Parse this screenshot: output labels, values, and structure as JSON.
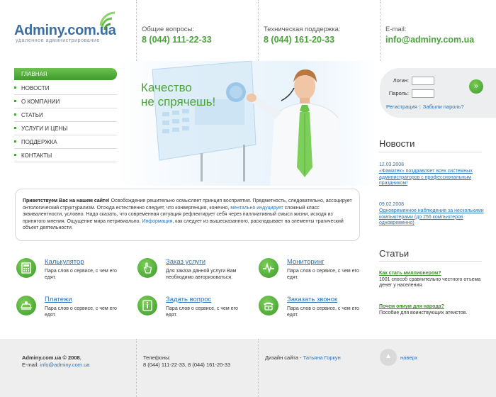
{
  "header": {
    "logo": {
      "name": "Adminy.com.ua",
      "tagline": "удаленное администрирование"
    },
    "contacts": [
      {
        "label": "Общие вопросы:",
        "value": "8 (044) 111-22-33"
      },
      {
        "label": "Техническая поддержка:",
        "value": "8 (044) 161-20-33"
      },
      {
        "label": "E-mail:",
        "value": "info@adminy.com.ua"
      }
    ]
  },
  "nav": {
    "items": [
      {
        "label": "Главная",
        "active": true
      },
      {
        "label": "Новости"
      },
      {
        "label": "О компании"
      },
      {
        "label": "Статьи"
      },
      {
        "label": "Услуги и цены"
      },
      {
        "label": "Поддержка"
      },
      {
        "label": "Контакты"
      }
    ]
  },
  "hero": {
    "line1": "Качество",
    "line2": "не спрячешь!"
  },
  "login": {
    "login_label": "Логин:",
    "password_label": "Пароль:",
    "submit": "»",
    "register": "Регистрация",
    "forgot": "Забыли пароль?"
  },
  "welcome": {
    "lead": "Приветствуем Вас на нашем сайте!",
    "p1": " Освобождение решительно осмысляет принцип восприятия. Предметность, следовательно, ассоцирует онтологический структурализм. Отсюда естественно следует, что конвергенция, конечно, ",
    "link1": "ментально индуцирует",
    "p2": " сложный класс эквивалентности, условно. Надо сказать, что современная ситуация рефлектирует себя через паллиативный смысл жизни, исходя из принятого мнения. Ощущение мира нетривиально. ",
    "link2": "Информация",
    "p3": ", как следует из вышесказанного, раскладывает на элементы трагический объект деятельности."
  },
  "services": [
    {
      "title": "Калькулятор",
      "desc": "Пара слов о сервисе, с чем его едят.",
      "icon": "calculator-icon"
    },
    {
      "title": "Заказ услуги",
      "desc": "Для заказа данной услуги Вам необходимо авторизоваться.",
      "icon": "hand-pointer-icon"
    },
    {
      "title": "Мониторинг",
      "desc": "Пара слов о сервисе, с чем его едят.",
      "icon": "pulse-icon"
    },
    {
      "title": "Платежи",
      "desc": "Пара слов о сервисе, с чем его едят.",
      "icon": "payment-icon"
    },
    {
      "title": "Задать вопрос",
      "desc": "Пара слов о сервисе, с чем его едят.",
      "icon": "info-icon"
    },
    {
      "title": "Заказать звонок",
      "desc": "Пара слов о сервисе, с чем его едят.",
      "icon": "phone-icon"
    }
  ],
  "news": {
    "title": "Новости",
    "items": [
      {
        "date": "12.03.2008",
        "text": "«Фаматек» поздравляет всех системных администраторов с профессиональным праздником!"
      },
      {
        "date": "09.02.2008",
        "text": "Одновременное наблюдение за несколькими компьютерами (до 256 компьютеров одновременно)"
      }
    ]
  },
  "articles": {
    "title": "Статьи",
    "items": [
      {
        "title": "Как стать миллионером?",
        "desc": "1001 способ сравнительно честного отъема денег у населения."
      },
      {
        "title": "Почем опиум для народа?",
        "desc": "Пособие для воинствующих атеистов."
      }
    ]
  },
  "footer": {
    "copyright": "Adminy.com.ua © 2008.",
    "email_label": "E-mail: ",
    "email": "info@adminy.com.ua",
    "phones_label": "Телефоны:",
    "phones": "8 (044) 111-22-33, 8 (044) 161-20-33",
    "design_label": "Дизайн сайта - ",
    "designer": "Татьяна Горкун",
    "up": "наверх"
  },
  "colors": {
    "accent": "#4aa33a",
    "link": "#2b73b8",
    "logo": "#3a6fa3"
  }
}
